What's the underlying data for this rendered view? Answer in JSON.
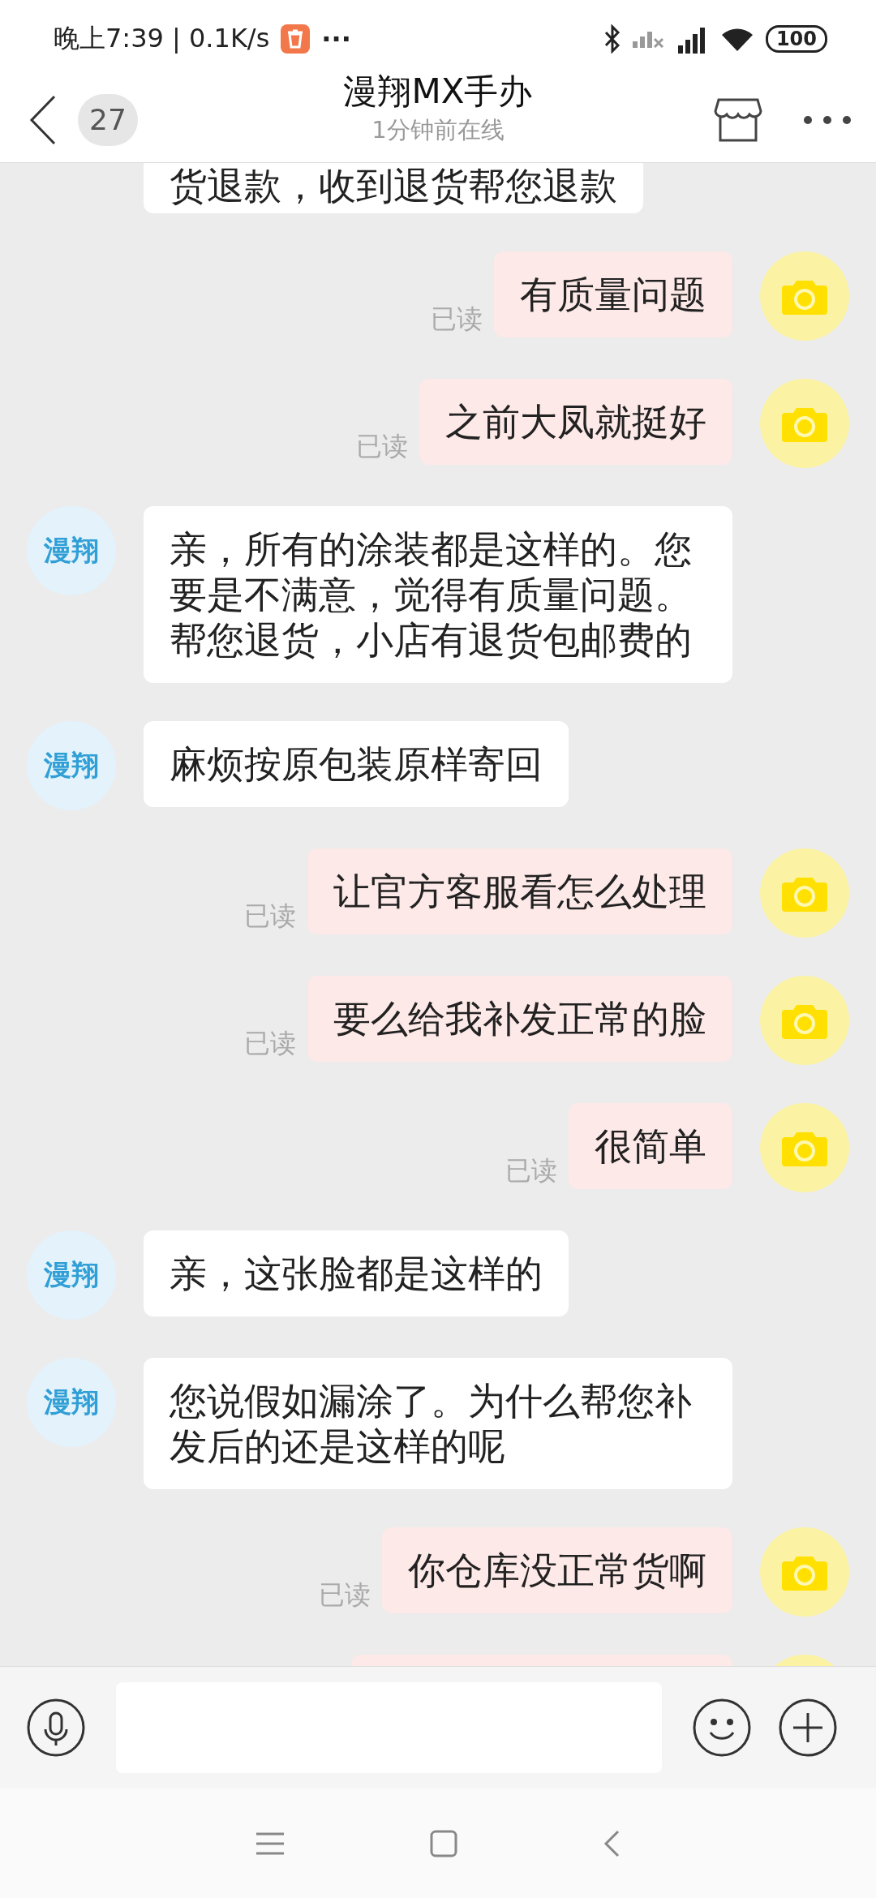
{
  "status_bar": {
    "time": "晚上7:39 | 0.1K/s",
    "more": "···",
    "battery": "100"
  },
  "header": {
    "unread": "27",
    "title": "漫翔MX手办",
    "subtitle": "1分钟前在线"
  },
  "messages": [
    {
      "kind": "incoming",
      "text": "货退款，收到退货帮您退款"
    },
    {
      "kind": "outgoing",
      "text": "有质量问题",
      "receipt": "已读"
    },
    {
      "kind": "outgoing",
      "text": "之前大凤就挺好",
      "receipt": "已读"
    },
    {
      "kind": "incoming",
      "avatar_text": "漫翔",
      "text": "亲，所有的涂装都是这样的。您要是不满意，觉得有质量问题。帮您退货，小店有退货包邮费的"
    },
    {
      "kind": "incoming",
      "avatar_text": "漫翔",
      "text": "麻烦按原包装原样寄回"
    },
    {
      "kind": "outgoing",
      "text": "让官方客服看怎么处理",
      "receipt": "已读"
    },
    {
      "kind": "outgoing",
      "text": "要么给我补发正常的脸",
      "receipt": "已读"
    },
    {
      "kind": "outgoing",
      "text": "很简单",
      "receipt": "已读"
    },
    {
      "kind": "incoming",
      "avatar_text": "漫翔",
      "text": "亲，这张脸都是这样的"
    },
    {
      "kind": "incoming",
      "avatar_text": "漫翔",
      "text": "您说假如漏涂了。为什么帮您补发后的还是这样的呢"
    },
    {
      "kind": "outgoing",
      "text": "你仓库没正常货啊",
      "receipt": "已读"
    },
    {
      "kind": "outgoing_cut"
    }
  ]
}
